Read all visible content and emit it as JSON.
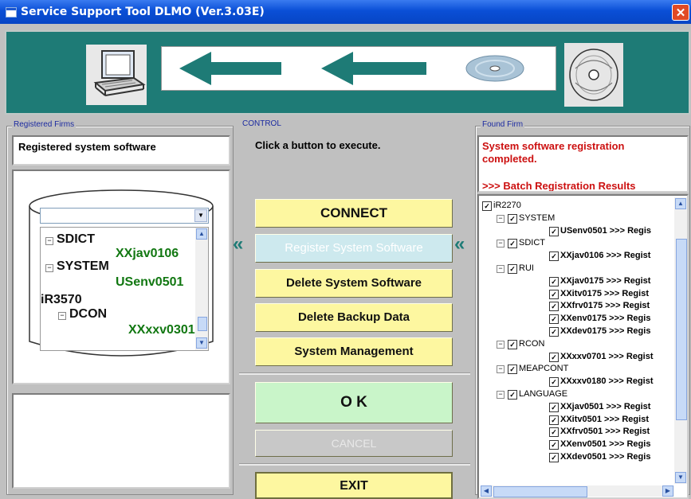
{
  "window": {
    "title": "Service Support Tool DLMO (Ver.3.03E)",
    "close_glyph": "✕"
  },
  "groups": {
    "registered": "Registered Firms",
    "control": "CONTROL",
    "found": "Found Firm"
  },
  "left": {
    "header_text": "Registered system software",
    "dropdown_value": "",
    "tree": [
      {
        "text": "SDICT",
        "kind": "node",
        "level": 1
      },
      {
        "text": "XXjav0106",
        "kind": "leaf",
        "level": 2
      },
      {
        "text": "SYSTEM",
        "kind": "node",
        "level": 1
      },
      {
        "text": "USenv0501",
        "kind": "leaf",
        "level": 2
      },
      {
        "text": "iR3570",
        "kind": "root",
        "level": 0
      },
      {
        "text": "DCON",
        "kind": "node",
        "level": 1
      },
      {
        "text": "XXxxv0301",
        "kind": "leaf",
        "level": 2
      }
    ]
  },
  "control": {
    "prompt": "Click a button to execute.",
    "connect": "CONNECT",
    "register": "Register System Software",
    "register_arrow": "«",
    "delete_sw": "Delete System Software",
    "delete_backup": "Delete Backup Data",
    "sys_mgmt": "System Management",
    "ok": "O K",
    "cancel": "CANCEL",
    "exit": "EXIT"
  },
  "right": {
    "status_line1": "System software registration",
    "status_line2": "completed.",
    "batch": ">>> Batch Registration Results",
    "tree": [
      {
        "text": "iR2270",
        "level": 0
      },
      {
        "text": "SYSTEM",
        "level": 1
      },
      {
        "text": "USenv0501 >>> Regis",
        "level": 2
      },
      {
        "text": "SDICT",
        "level": 1
      },
      {
        "text": "XXjav0106 >>> Regist",
        "level": 2
      },
      {
        "text": "RUI",
        "level": 1
      },
      {
        "text": "XXjav0175 >>> Regist",
        "level": 2
      },
      {
        "text": "XXitv0175 >>> Regist",
        "level": 2
      },
      {
        "text": "XXfrv0175 >>> Regist",
        "level": 2
      },
      {
        "text": "XXenv0175 >>> Regis",
        "level": 2
      },
      {
        "text": "XXdev0175 >>> Regis",
        "level": 2
      },
      {
        "text": "RCON",
        "level": 1
      },
      {
        "text": "XXxxv0701 >>> Regist",
        "level": 2
      },
      {
        "text": "MEAPCONT",
        "level": 1
      },
      {
        "text": "XXxxv0180 >>> Regist",
        "level": 2
      },
      {
        "text": "LANGUAGE",
        "level": 1
      },
      {
        "text": "XXjav0501 >>> Regist",
        "level": 2
      },
      {
        "text": "XXitv0501 >>> Regist",
        "level": 2
      },
      {
        "text": "XXfrv0501 >>> Regist",
        "level": 2
      },
      {
        "text": "XXenv0501 >>> Regis",
        "level": 2
      },
      {
        "text": "XXdev0501 >>> Regis",
        "level": 2
      }
    ]
  }
}
